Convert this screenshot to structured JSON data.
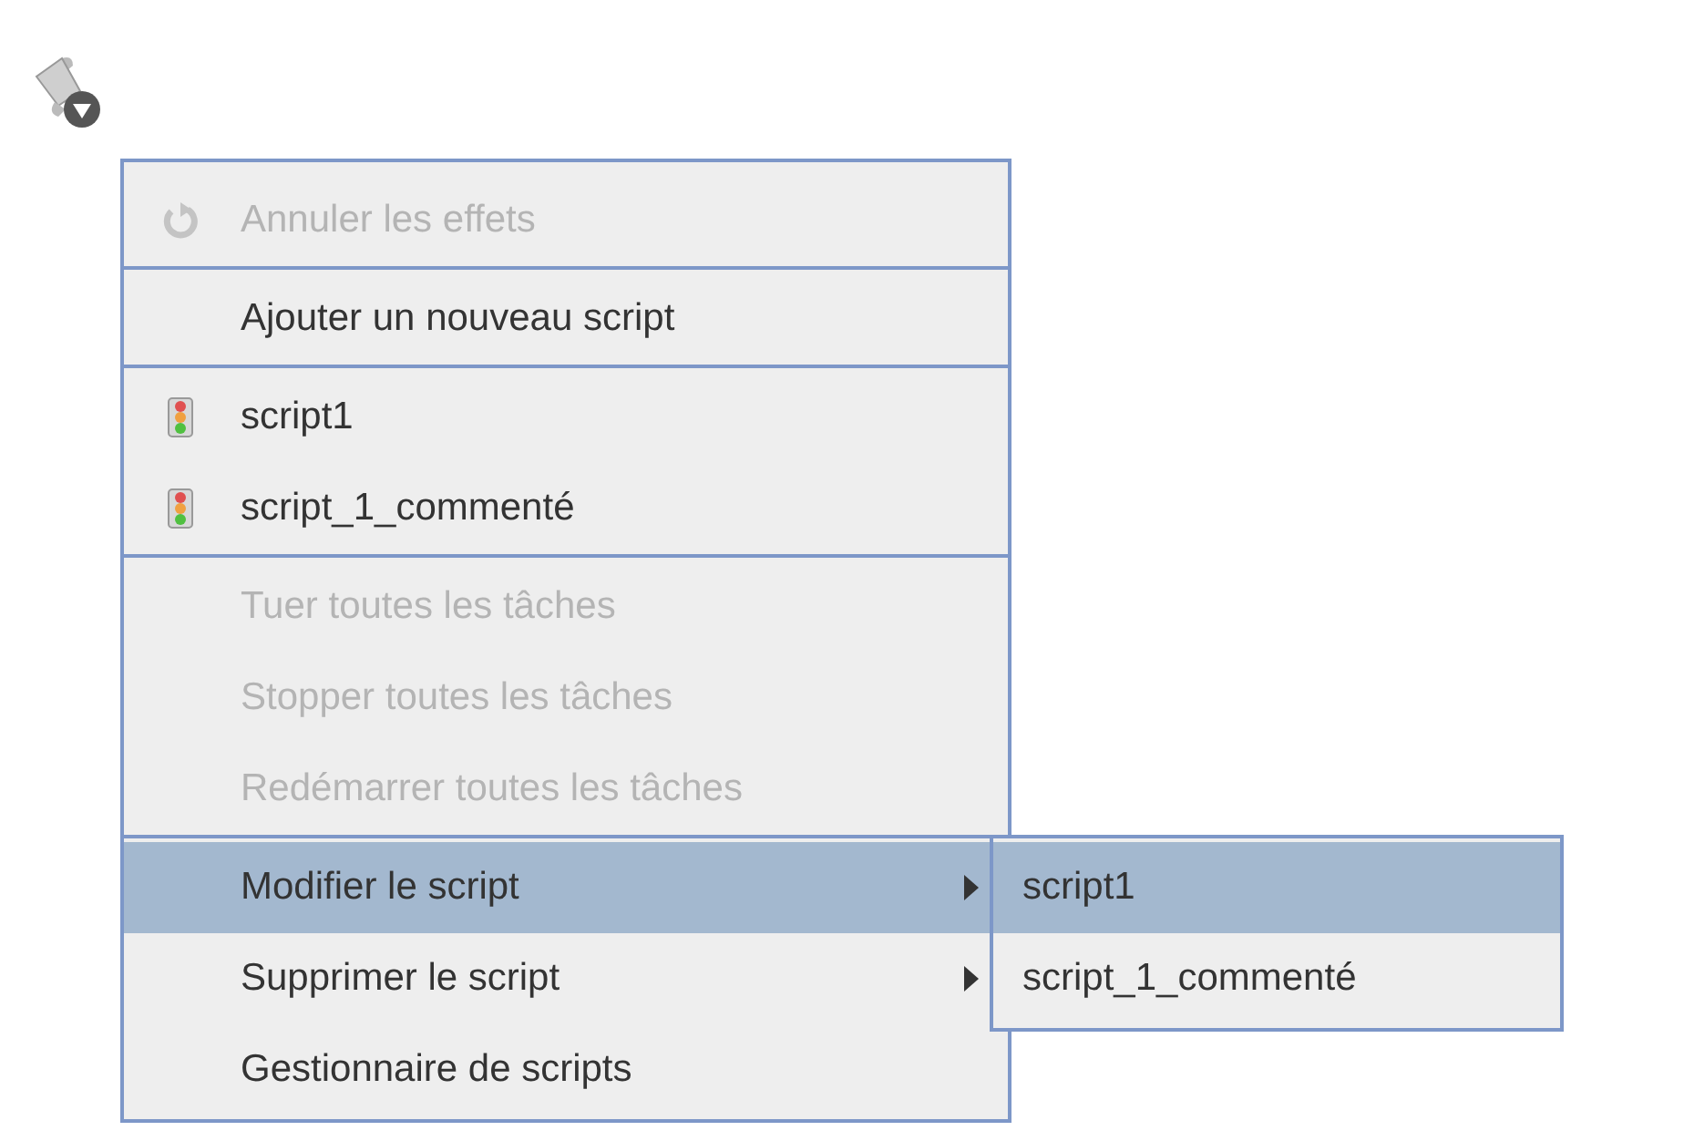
{
  "menu": {
    "groups": [
      [
        {
          "label": "Annuler les effets",
          "kind": "undo",
          "disabled": true,
          "selected": false,
          "submenu": false
        }
      ],
      [
        {
          "label": "Ajouter un nouveau script",
          "kind": "plain",
          "disabled": false,
          "selected": false,
          "submenu": false
        }
      ],
      [
        {
          "label": "script1",
          "kind": "script",
          "disabled": false,
          "selected": false,
          "submenu": false
        },
        {
          "label": "script_1_commenté",
          "kind": "script",
          "disabled": false,
          "selected": false,
          "submenu": false
        }
      ],
      [
        {
          "label": "Tuer toutes les tâches",
          "kind": "plain",
          "disabled": true,
          "selected": false,
          "submenu": false
        },
        {
          "label": "Stopper toutes les tâches",
          "kind": "plain",
          "disabled": true,
          "selected": false,
          "submenu": false
        },
        {
          "label": "Redémarrer toutes les tâches",
          "kind": "plain",
          "disabled": true,
          "selected": false,
          "submenu": false
        }
      ],
      [
        {
          "label": "Modifier le script",
          "kind": "plain",
          "disabled": false,
          "selected": true,
          "submenu": true
        },
        {
          "label": "Supprimer le script",
          "kind": "plain",
          "disabled": false,
          "selected": false,
          "submenu": true
        },
        {
          "label": "Gestionnaire de scripts",
          "kind": "plain",
          "disabled": false,
          "selected": false,
          "submenu": false
        }
      ]
    ]
  },
  "submenu": {
    "items": [
      {
        "label": "script1",
        "selected": true
      },
      {
        "label": "script_1_commenté",
        "selected": false
      }
    ]
  }
}
